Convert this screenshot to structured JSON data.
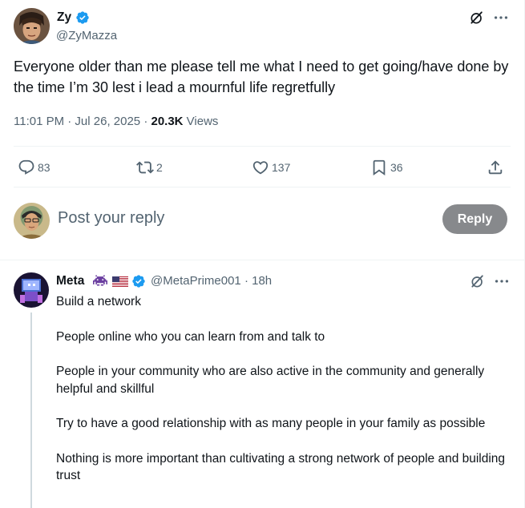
{
  "main_tweet": {
    "author_name": "Zy",
    "author_handle": "@ZyMazza",
    "text": "Everyone older than me please tell me what I need to get going/have done by the time I’m 30 lest i lead a mournful life regretfully",
    "timestamp": "11:01 PM · Jul 26, 2025 · ",
    "views_count": "20.3K",
    "views_label": " Views",
    "actions": {
      "replies": "83",
      "reposts": "2",
      "likes": "137",
      "bookmarks": "36"
    },
    "icons": [
      "verified-badge-icon",
      "grok-icon",
      "more-icon",
      "reply-icon",
      "repost-icon",
      "like-icon",
      "bookmark-icon",
      "share-icon"
    ]
  },
  "composer": {
    "placeholder": "Post your reply",
    "button_label": "Reply"
  },
  "reply_tweet": {
    "author_name": "Meta",
    "author_handle": "@MetaPrime001 · 18h",
    "paragraphs": [
      "Build a network",
      "People online who you can learn from and talk to",
      "People in your community who are also active in the community and generally helpful and skillful",
      "Try to have a good relationship with as many people in your family as possible",
      "Nothing is more important than cultivating a strong network of people and building trust"
    ]
  },
  "colors": {
    "verified_blue": "#1d9bf0",
    "secondary_text": "#536471",
    "reply_button_bg": "#87898c",
    "divider": "#eff3f4"
  }
}
